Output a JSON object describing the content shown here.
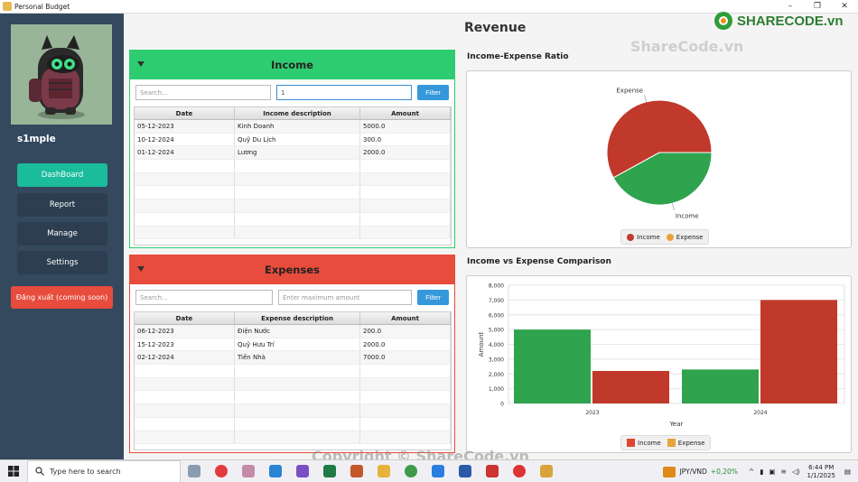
{
  "window": {
    "title": "Personal Budget",
    "controls": [
      "–",
      "❐",
      "✕"
    ]
  },
  "user": {
    "name": "s1mple",
    "avatar_icon": "among-us-character-icon"
  },
  "nav": {
    "dashboard": "DashBoard",
    "report": "Report",
    "manage": "Manage",
    "settings": "Settings",
    "logout": "Đăng xuất (coming soon)"
  },
  "page": {
    "title": "Revenue"
  },
  "income": {
    "title": "Income",
    "search_placeholder": "Search...",
    "filter_value": "1",
    "filter_label": "Filter",
    "columns": [
      "Date",
      "Income description",
      "Amount"
    ],
    "rows": [
      [
        "05-12-2023",
        "Kinh Doanh",
        "5000.0"
      ],
      [
        "10-12-2024",
        "Quỹ Du Lịch",
        "300.0"
      ],
      [
        "01-12-2024",
        "Lương",
        "2000.0"
      ]
    ]
  },
  "expenses": {
    "title": "Expenses",
    "search_placeholder": "Search...",
    "max_placeholder": "Enter maximum amount",
    "filter_label": "Filter",
    "columns": [
      "Date",
      "Expense description",
      "Amount"
    ],
    "rows": [
      [
        "06-12-2023",
        "Điện Nước",
        "200.0"
      ],
      [
        "15-12-2023",
        "Quỹ Hưu Trí",
        "2000.0"
      ],
      [
        "02-12-2024",
        "Tiền Nhà",
        "7000.0"
      ]
    ]
  },
  "ratio_chart": {
    "title": "Income-Expense Ratio",
    "legend": [
      "Income",
      "Expense"
    ],
    "colors": {
      "income": "#2fa34e",
      "expense": "#c0392b",
      "expense_legend": "#e8a33a",
      "income_legend": "#c0392b"
    }
  },
  "chart_data": [
    {
      "type": "pie",
      "title": "Income-Expense Ratio",
      "labels": [
        "Expense",
        "Income"
      ],
      "values": [
        58,
        42
      ]
    },
    {
      "type": "bar",
      "title": "Income vs Expense Comparison",
      "categories": [
        "2023",
        "2024"
      ],
      "series": [
        {
          "name": "Income",
          "values": [
            5000,
            2300
          ]
        },
        {
          "name": "Expense",
          "values": [
            2200,
            7000
          ]
        }
      ],
      "xlabel": "Year",
      "ylabel": "Amount",
      "ylim": [
        0,
        8000
      ],
      "yticks": [
        "0",
        "1,000",
        "2,000",
        "3,000",
        "4,000",
        "5,000",
        "6,000",
        "7,000",
        "8,000"
      ],
      "legend": [
        "Income",
        "Expense"
      ]
    }
  ],
  "bar_chart": {
    "title": "Income vs Expense Comparison"
  },
  "taskbar": {
    "search_placeholder": "Type here to search",
    "currency": "JPY/VND",
    "currency_change": "+0,20%",
    "time": "6:44 PM",
    "date": "1/1/2025"
  },
  "watermarks": {
    "top": "ShareCode.vn",
    "bottom": "Copyright © ShareCode.vn",
    "logo": "SHARECODE.vn"
  }
}
